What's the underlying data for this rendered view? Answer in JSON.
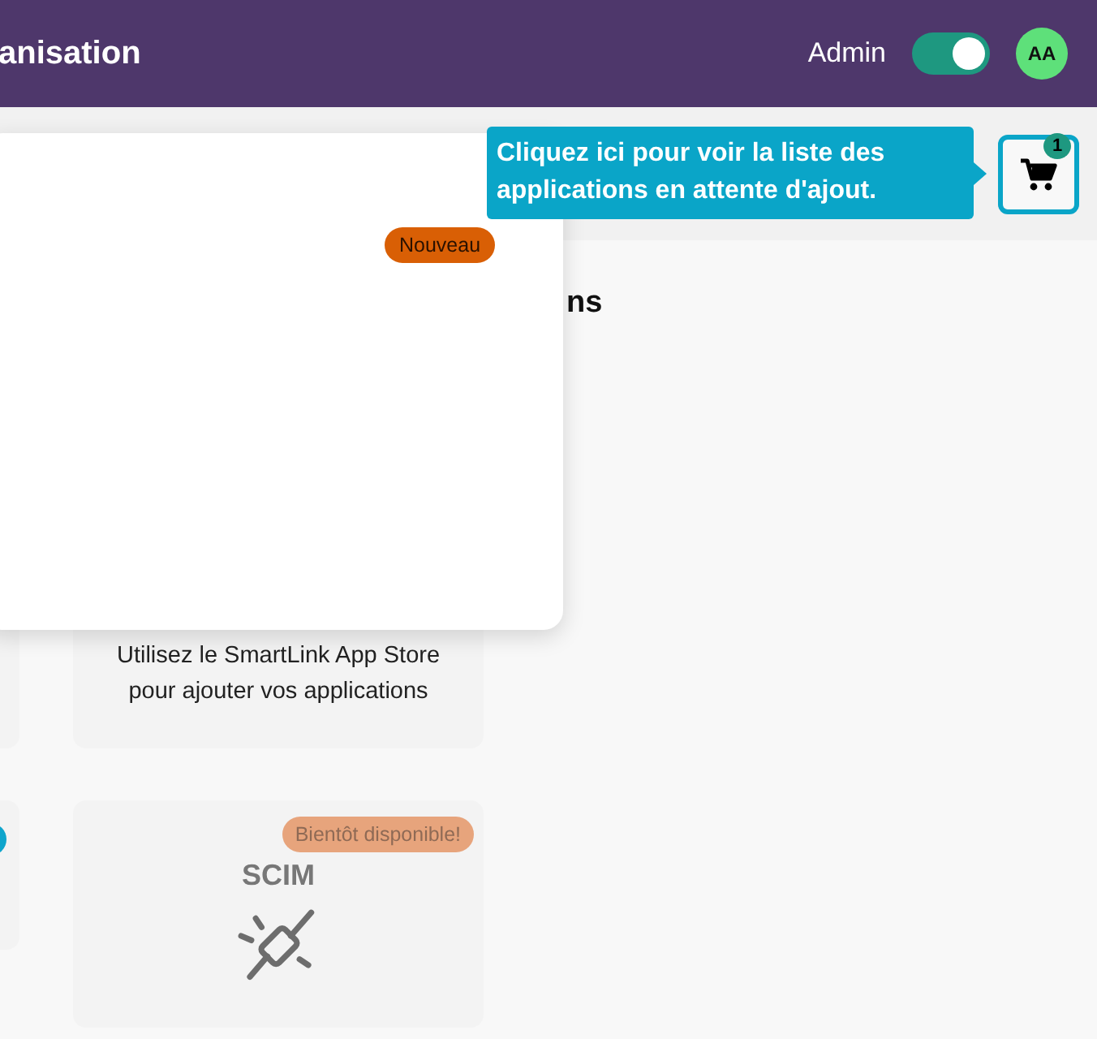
{
  "header": {
    "title": "anisation",
    "role_label": "Admin",
    "admin_mode": {
      "on": true
    },
    "avatar": "AA"
  },
  "section_heading": "ns",
  "popup_card": {
    "badge": "Nouveau"
  },
  "tooltip": "Cliquez ici pour voir la liste des applications en attente d'ajout.",
  "cart": {
    "count": "1"
  },
  "cards": [
    {
      "kind": "info",
      "text": "Utilisez le SmartLink App Store pour ajouter vos applications"
    },
    {
      "kind": "upcoming",
      "badge": "Bientôt disponible!",
      "title": "SCIM"
    }
  ]
}
